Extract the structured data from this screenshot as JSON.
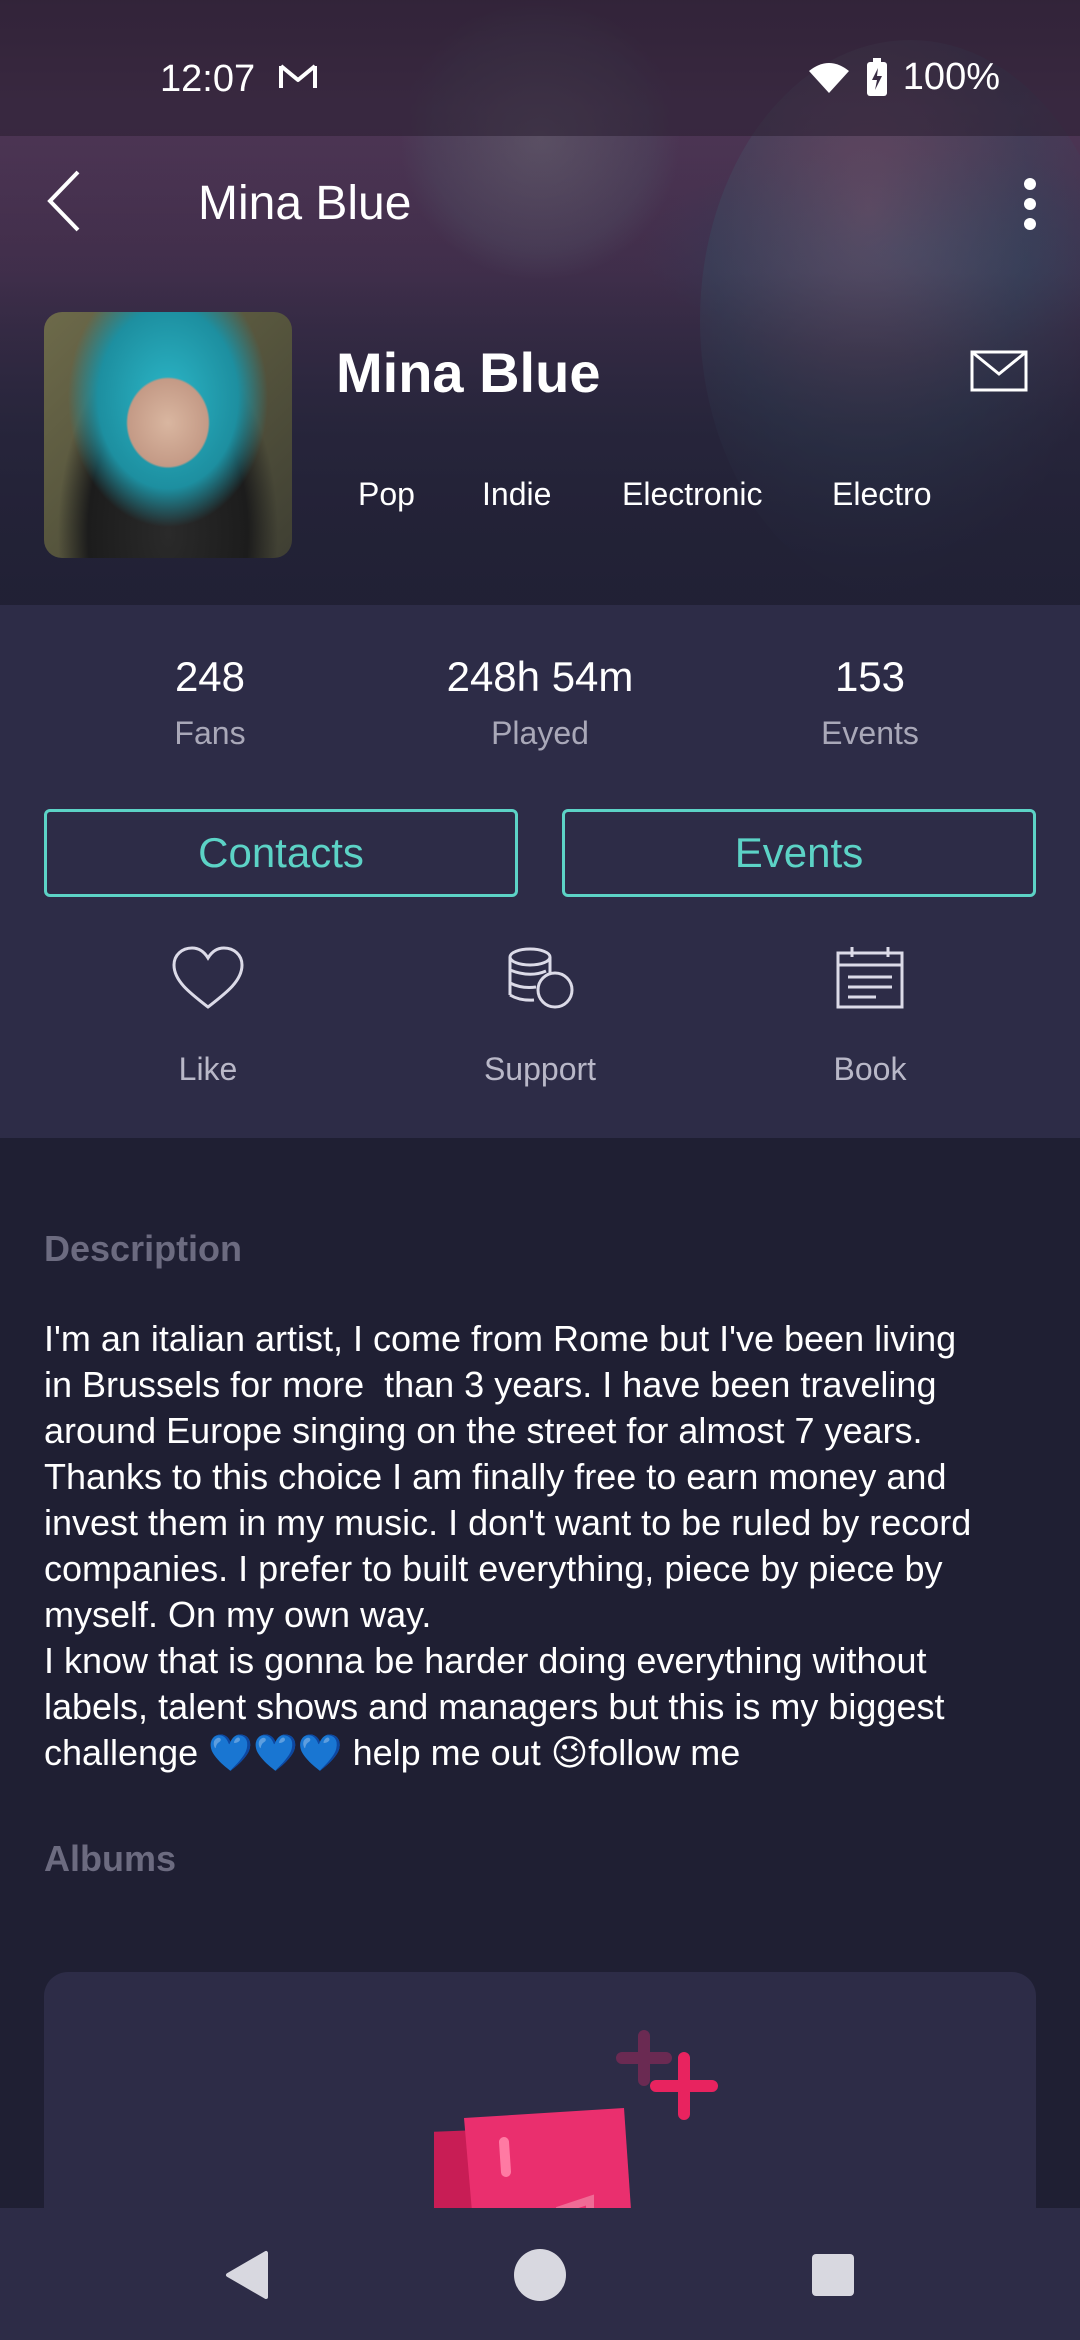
{
  "status": {
    "time": "12:07",
    "battery": "100%",
    "icons": [
      "gmail-icon",
      "wifi-icon",
      "battery-charging-icon"
    ]
  },
  "appbar": {
    "title": "Mina Blue",
    "back_icon": "chevron-left-icon",
    "more_icon": "more-vert-icon"
  },
  "profile": {
    "name": "Mina Blue",
    "genres": [
      "Pop",
      "Indie",
      "Electronic",
      "Electro"
    ],
    "message_icon": "mail-icon"
  },
  "stats": [
    {
      "value": "248",
      "label": "Fans"
    },
    {
      "value": "248h 54m",
      "label": "Played"
    },
    {
      "value": "153",
      "label": "Events"
    }
  ],
  "buttons": {
    "contacts": "Contacts",
    "events": "Events"
  },
  "actions": [
    {
      "label": "Like",
      "icon": "heart-icon"
    },
    {
      "label": "Support",
      "icon": "coins-icon"
    },
    {
      "label": "Book",
      "icon": "calendar-icon"
    }
  ],
  "description": {
    "title": "Description",
    "text": "I'm an italian artist, I come from Rome but I've been living\nin Brussels for more  than 3 years. I have been traveling\naround Europe singing on the street for almost 7 years.\nThanks to this choice I am finally free to earn money and\ninvest them in my music. I don't want to be ruled by record\ncompanies. I prefer to built everything, piece by piece by\nmyself. On my own way.\nI know that is gonna be harder doing everything without\nlabels, talent shows and managers but this is my biggest\nchallenge 💙💙💙 help me out 😉follow me"
  },
  "albums": {
    "title": "Albums",
    "add_icon": "add-album-icon"
  },
  "colors": {
    "accent": "#5cd3c6",
    "panel": "#2d2c47",
    "background": "#1f1f33",
    "pink": "#e8235f"
  },
  "navbar": {
    "icons": [
      "nav-back-icon",
      "nav-home-icon",
      "nav-recents-icon"
    ]
  }
}
